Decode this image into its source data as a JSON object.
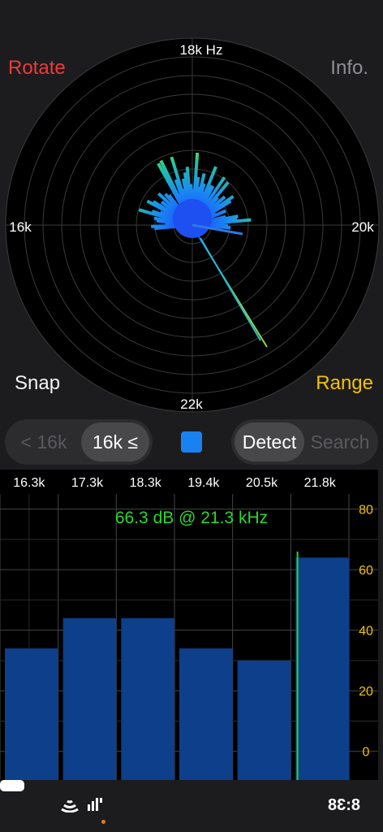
{
  "controls": {
    "rotate_label": "Rotate",
    "info_label": "Info.",
    "snap_label": "Snap",
    "range_label": "Range"
  },
  "radar": {
    "labels": {
      "top": "18k Hz",
      "left": "16k",
      "right": "20k",
      "bottom": "22k"
    },
    "ring_count": 10
  },
  "segments": {
    "range": [
      "< 16k",
      "16k ≤"
    ],
    "range_selected": 1,
    "mode": [
      "Detect",
      "Search"
    ],
    "mode_selected": 0
  },
  "colors": {
    "accent": "#1883f0",
    "rotate": "#ec3b3b",
    "range": "#f2c200",
    "readout": "#2bd62b",
    "bar": "#0d3f8a"
  },
  "spectrum": {
    "readout": "66.3 dB @ 21.3 kHz",
    "peak_khz": 21.3
  },
  "chart_data": {
    "type": "bar",
    "categories": [
      "16.3k",
      "17.3k",
      "18.3k",
      "19.4k",
      "20.5k",
      "21.8k"
    ],
    "values": [
      34,
      44,
      44,
      34,
      30,
      64
    ],
    "ylim": [
      -10,
      85
    ],
    "yticks": [
      0,
      20,
      40,
      60,
      80
    ],
    "grid": true
  },
  "status_bar": {
    "time": "8:38"
  }
}
